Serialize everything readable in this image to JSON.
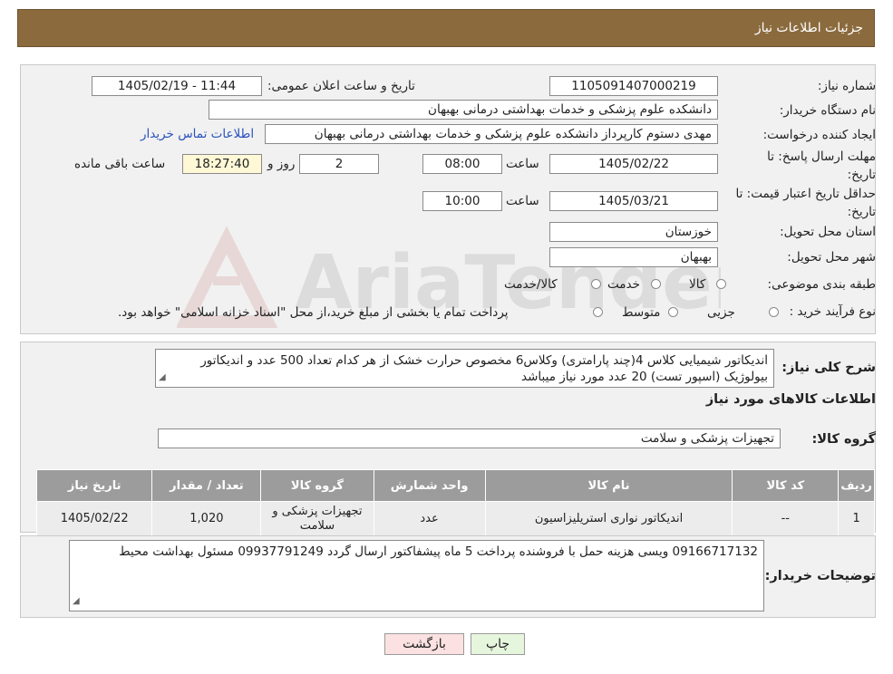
{
  "header": {
    "title": "جزئیات اطلاعات نیاز"
  },
  "fields": {
    "need_number_label": "شماره نیاز:",
    "need_number": "1105091407000219",
    "announce_label": "تاریخ و ساعت اعلان عمومی:",
    "announce_value": "1405/02/19 - 11:44",
    "buyer_org_label": "نام دستگاه خریدار:",
    "buyer_org": "دانشکده علوم پزشکی و خدمات بهداشتی  درمانی بهبهان",
    "creator_label": "ایجاد کننده درخواست:",
    "creator": "مهدی دستوم کارپرداز دانشکده علوم پزشکی و خدمات بهداشتی  درمانی بهبهان",
    "contact_link": "اطلاعات تماس خریدار",
    "deadline_label": "مهلت ارسال پاسخ: تا تاریخ:",
    "deadline_date": "1405/02/22",
    "time_label": "ساعت",
    "deadline_time": "08:00",
    "days_value": "2",
    "days_label": "روز و",
    "remaining_time": "18:27:40",
    "remaining_label": "ساعت باقی مانده",
    "validity_label": "حداقل تاریخ اعتبار قیمت: تا تاریخ:",
    "validity_date": "1405/03/21",
    "validity_time": "10:00",
    "province_label": "استان محل تحویل:",
    "province": "خوزستان",
    "city_label": "شهر محل تحویل:",
    "city": "بهبهان",
    "category_label": "طبقه بندی موضوعی:",
    "category_options": [
      "کالا",
      "خدمت",
      "کالا/خدمت"
    ],
    "process_label": "نوع فرآیند خرید :",
    "process_options": [
      "جزیی",
      "متوسط"
    ],
    "process_note": "پرداخت تمام یا بخشی از مبلغ خرید،از محل \"اسناد خزانه اسلامی\" خواهد بود."
  },
  "description": {
    "label": "شرح کلی نیاز:",
    "text": "اندیکاتور شیمیایی کلاس 4(چند پارامتری) وکلاس6  مخصوص حرارت خشک از هر کدام تعداد 500 عدد و اندیکاتور بیولوژیک (اسپور تست) 20 عدد مورد نیاز میباشد"
  },
  "goods_info_title": "اطلاعات کالاهای مورد نیاز",
  "goods_group": {
    "label": "گروه کالا:",
    "value": "تجهیزات پزشکی و سلامت"
  },
  "table": {
    "headers": [
      "ردیف",
      "کد کالا",
      "نام کالا",
      "واحد شمارش",
      "گروه کالا",
      "تعداد / مقدار",
      "تاریخ نیاز"
    ],
    "rows": [
      [
        "1",
        "--",
        "اندیکاتور نواری استریلیزاسیون",
        "عدد",
        "تجهیزات پزشکی و سلامت",
        "1,020",
        "1405/02/22"
      ]
    ]
  },
  "buyer_notes": {
    "label": "توضیحات خریدار:",
    "text": "09166717132 ویسی هزینه حمل با فروشنده پرداخت 5 ماه  پیشفاکتور ارسال گردد 09937791249 مسئول بهداشت محیط"
  },
  "buttons": {
    "print": "چاپ",
    "back": "بازگشت"
  },
  "colors": {
    "header": "#8b6b3e",
    "panel": "#f1f1f1",
    "table_header": "#9c9c9c",
    "link": "#2a52be",
    "back_button": "#fbe1e1",
    "print_button": "#e6f6dd"
  }
}
